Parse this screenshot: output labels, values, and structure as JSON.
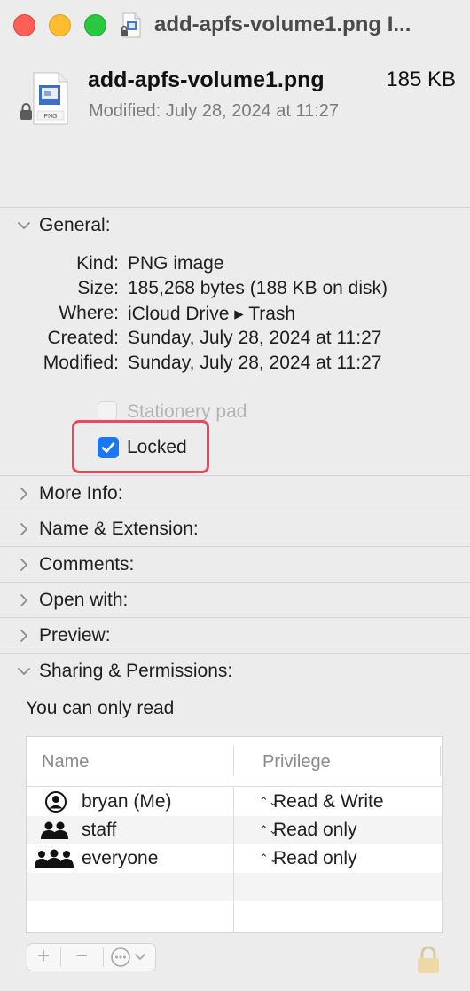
{
  "window": {
    "title": "add-apfs-volume1.png I...",
    "colors": {
      "close": "#ff5f57",
      "minimize": "#febc2e",
      "zoom": "#28c840"
    }
  },
  "header": {
    "file_name": "add-apfs-volume1.png",
    "file_size": "185 KB",
    "modified": "Modified: July 28, 2024 at 11:27",
    "icon": "png-file-icon",
    "icon_badge": "PNG"
  },
  "general": {
    "label": "General:",
    "expanded": true,
    "rows": [
      {
        "label": "Kind:",
        "value": "PNG image"
      },
      {
        "label": "Size:",
        "value": "185,268 bytes (188 KB on disk)"
      },
      {
        "label": "Where:",
        "value": "iCloud Drive ▸ Trash"
      },
      {
        "label": "Created:",
        "value": "Sunday, July 28, 2024 at 11:27"
      },
      {
        "label": "Modified:",
        "value": "Sunday, July 28, 2024 at 11:27"
      }
    ],
    "stationery": {
      "label": "Stationery pad",
      "checked": false,
      "enabled": false
    },
    "locked": {
      "label": "Locked",
      "checked": true
    },
    "highlight_color": "#e9485f"
  },
  "sections": [
    {
      "label": "More Info:",
      "expanded": false
    },
    {
      "label": "Name & Extension:",
      "expanded": false
    },
    {
      "label": "Comments:",
      "expanded": false
    },
    {
      "label": "Open with:",
      "expanded": false
    },
    {
      "label": "Preview:",
      "expanded": false
    },
    {
      "label": "Sharing & Permissions:",
      "expanded": true
    }
  ],
  "sharing": {
    "note": "You can only read",
    "columns": {
      "name": "Name",
      "privilege": "Privilege"
    },
    "rows": [
      {
        "name": "bryan (Me)",
        "privilege": "Read & Write",
        "icon": "user-icon"
      },
      {
        "name": "staff",
        "privilege": "Read only",
        "icon": "group-icon"
      },
      {
        "name": "everyone",
        "privilege": "Read only",
        "icon": "everyone-icon"
      }
    ],
    "updown_glyph": "⌃⌄"
  },
  "toolbar": {
    "add": "+",
    "remove": "−",
    "action_icon": "ellipsis-circle-icon",
    "lock_icon": "padlock-icon"
  }
}
